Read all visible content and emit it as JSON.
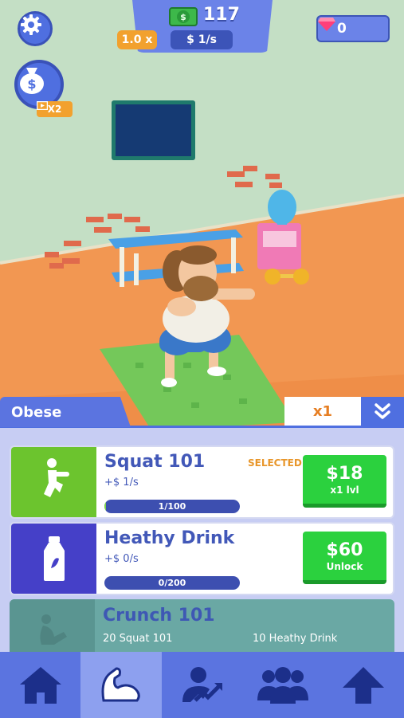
{
  "hud": {
    "money": "117",
    "multiplier": "1.0 x",
    "rate": "$ 1/s",
    "gems": "0",
    "ad_bonus": "X2",
    "cash_symbol": "$"
  },
  "panel": {
    "level_name": "Obese",
    "buy_multiplier": "x1"
  },
  "exercises": [
    {
      "title": "Squat 101",
      "income": "+$ 1/s",
      "status": "SELECTED",
      "progress_text": "1/100",
      "progress": 0.01,
      "button_price": "$18",
      "button_sub": "x1 lvl",
      "icon": "squat-icon"
    },
    {
      "title": "Heathy Drink",
      "income": "+$ 0/s",
      "status": "",
      "progress_text": "0/200",
      "progress": 0.0,
      "button_price": "$60",
      "button_sub": "Unlock",
      "icon": "bottle-icon"
    }
  ],
  "locked": {
    "title": "Crunch 101",
    "requirement_1": "20 Squat 101",
    "requirement_2": "10 Heathy Drink",
    "icon": "crunch-icon"
  },
  "nav": [
    "home-icon",
    "muscle-icon",
    "trainer-icon",
    "group-icon",
    "upgrade-arrow-icon"
  ],
  "colors": {
    "primary": "#5b74e0",
    "green": "#2bd13e",
    "orange": "#f2a12e"
  }
}
